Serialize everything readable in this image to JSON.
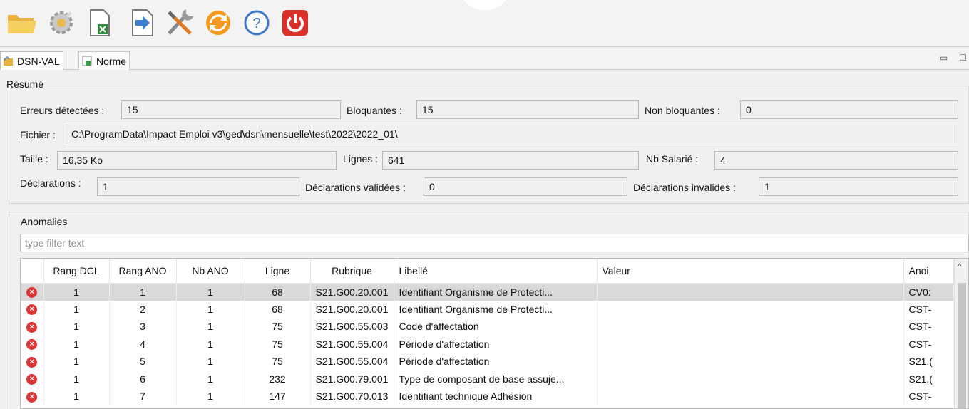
{
  "toolbar": {
    "buttons": [
      {
        "name": "open-folder-icon"
      },
      {
        "name": "settings-gear-icon"
      },
      {
        "name": "export-excel-icon"
      },
      {
        "name": "import-arrow-icon"
      },
      {
        "name": "tools-icon"
      },
      {
        "name": "refresh-icon"
      },
      {
        "name": "help-icon",
        "glyph": "?"
      },
      {
        "name": "power-icon"
      }
    ]
  },
  "tabs": [
    {
      "label": "DSN-VAL"
    },
    {
      "label": "Norme"
    }
  ],
  "window_controls": {
    "minimize": "▭",
    "maximize": "☐"
  },
  "resume": {
    "title": "Résumé",
    "erreurs_label": "Erreurs détectées :",
    "erreurs_value": "15",
    "bloquantes_label": "Bloquantes :",
    "bloquantes_value": "15",
    "non_bloquantes_label": "Non bloquantes :",
    "non_bloquantes_value": "0",
    "fichier_label": "Fichier :",
    "fichier_value": "C:\\ProgramData\\Impact Emploi v3\\ged\\dsn\\mensuelle\\test\\2022\\2022_01\\",
    "taille_label": "Taille :",
    "taille_value": "16,35 Ko",
    "lignes_label": "Lignes :",
    "lignes_value": "641",
    "nb_salarie_label": "Nb Salarié :",
    "nb_salarie_value": "4",
    "declarations_label": "Déclarations :",
    "declarations_value": "1",
    "declarations_validees_label": "Déclarations validées :",
    "declarations_validees_value": "0",
    "declarations_invalides_label": "Déclarations invalides :",
    "declarations_invalides_value": "1"
  },
  "anomalies": {
    "title": "Anomalies",
    "filter_placeholder": "type filter text",
    "columns": [
      "",
      "Rang DCL",
      "Rang ANO",
      "Nb ANO",
      "Ligne",
      "Rubrique",
      "Libellé",
      "Valeur",
      "Anoi"
    ],
    "rows": [
      {
        "icon": "×",
        "rang_dcl": "1",
        "rang_ano": "1",
        "nb_ano": "1",
        "ligne": "68",
        "rubrique": "S21.G00.20.001",
        "libelle": "Identifiant Organisme de Protecti...",
        "valeur": "",
        "anomalie": "CV0:"
      },
      {
        "icon": "×",
        "rang_dcl": "1",
        "rang_ano": "2",
        "nb_ano": "1",
        "ligne": "68",
        "rubrique": "S21.G00.20.001",
        "libelle": "Identifiant Organisme de Protecti...",
        "valeur": "",
        "anomalie": "CST-"
      },
      {
        "icon": "×",
        "rang_dcl": "1",
        "rang_ano": "3",
        "nb_ano": "1",
        "ligne": "75",
        "rubrique": "S21.G00.55.003",
        "libelle": "Code d'affectation",
        "valeur": "",
        "anomalie": "CST-"
      },
      {
        "icon": "×",
        "rang_dcl": "1",
        "rang_ano": "4",
        "nb_ano": "1",
        "ligne": "75",
        "rubrique": "S21.G00.55.004",
        "libelle": "Période d'affectation",
        "valeur": "",
        "anomalie": "CST-"
      },
      {
        "icon": "×",
        "rang_dcl": "1",
        "rang_ano": "5",
        "nb_ano": "1",
        "ligne": "75",
        "rubrique": "S21.G00.55.004",
        "libelle": "Période d'affectation",
        "valeur": "",
        "anomalie": "S21.("
      },
      {
        "icon": "×",
        "rang_dcl": "1",
        "rang_ano": "6",
        "nb_ano": "1",
        "ligne": "232",
        "rubrique": "S21.G00.79.001",
        "libelle": "Type de composant de base assuje...",
        "valeur": "",
        "anomalie": "S21.("
      },
      {
        "icon": "×",
        "rang_dcl": "1",
        "rang_ano": "7",
        "nb_ano": "1",
        "ligne": "147",
        "rubrique": "S21.G00.70.013",
        "libelle": "Identifiant technique Adhésion",
        "valeur": "",
        "anomalie": "CST-"
      }
    ],
    "selected_row_index": 0,
    "scroll_up_glyph": "^"
  },
  "colors": {
    "error_red": "#dd3535",
    "selected_row": "#d9d9d9"
  }
}
